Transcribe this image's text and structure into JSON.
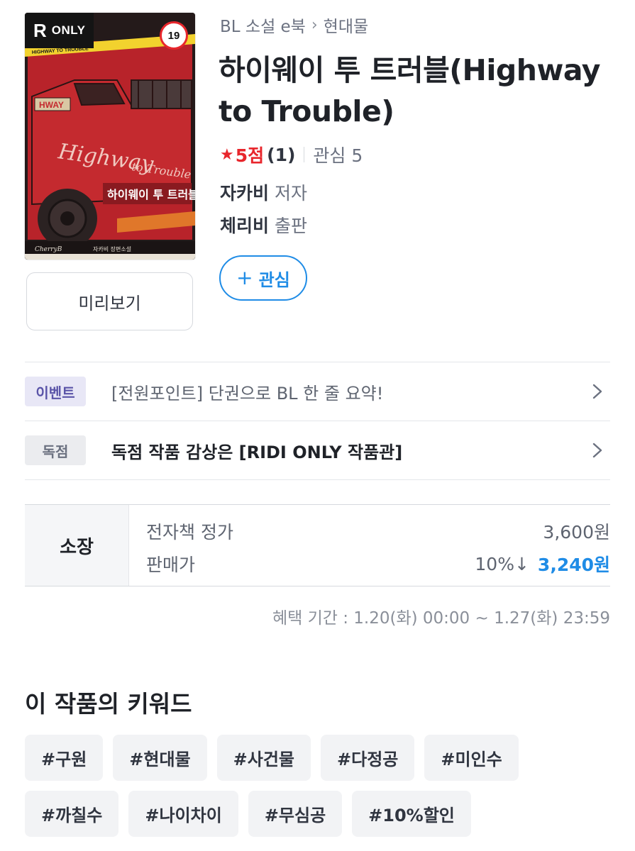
{
  "cover": {
    "badge_r": "R",
    "badge_text": "ONLY",
    "age_rating": "19",
    "art_title_script": "Highway",
    "art_title_script2": "to Trouble",
    "art_title_korean": "하이웨이 투 트러블",
    "art_tape_text": "HIGHWAY TO TROUBLE",
    "art_footer": "자카비 장편소설",
    "art_logo": "CherryB",
    "art_plate": "HWAY"
  },
  "preview_button": "미리보기",
  "breadcrumb": {
    "category": "BL 소설 e북",
    "separator": "›",
    "genre": "현대물"
  },
  "title": "하이웨이 투 트러블(Highway to Trouble)",
  "rating": {
    "star": "★",
    "score": "5점",
    "count": "(1)",
    "interest": "관심 5"
  },
  "author": {
    "name": "자카비",
    "role": "저자"
  },
  "publisher": {
    "name": "체리비",
    "role": "출판"
  },
  "favorite_button": {
    "plus": "+",
    "label": "관심"
  },
  "notices": [
    {
      "tag": "이벤트",
      "text": "[전원포인트] 단권으로 BL 한 줄 요약!"
    },
    {
      "tag": "독점",
      "text": "독점 작품 감상은 [RIDI ONLY 작품관]"
    }
  ],
  "price": {
    "section_label": "소장",
    "list_label": "전자책 정가",
    "list_price": "3,600원",
    "sale_label": "판매가",
    "discount": "10%↓",
    "sale_price": "3,240원"
  },
  "benefit_period": "혜택 기간 : 1.20(화) 00:00 ~ 1.27(화) 23:59",
  "keywords_heading": "이 작품의 키워드",
  "keywords": [
    "#구원",
    "#현대물",
    "#사건물",
    "#다정공",
    "#미인수",
    "#까칠수",
    "#나이차이",
    "#무심공",
    "#10%할인"
  ],
  "colors": {
    "accent_blue": "#1f8ce6",
    "rating_red": "#e8262c",
    "event_purple": "#5a54a8"
  }
}
